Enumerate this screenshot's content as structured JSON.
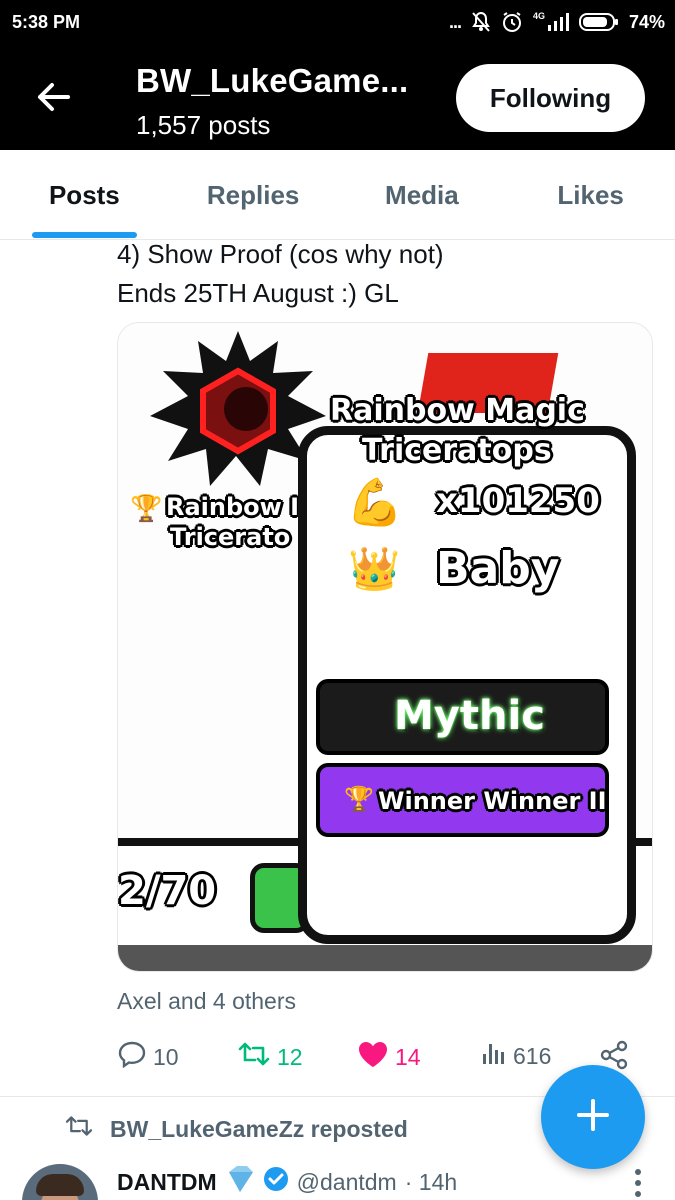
{
  "status_bar": {
    "time": "5:38 PM",
    "dots": "...",
    "network": "4G",
    "battery": "74%"
  },
  "header": {
    "title": "BW_LukeGame...",
    "subtitle": "1,557 posts",
    "follow_label": "Following"
  },
  "tabs": [
    {
      "label": "Posts",
      "active": true
    },
    {
      "label": "Replies",
      "active": false
    },
    {
      "label": "Media",
      "active": false
    },
    {
      "label": "Likes",
      "active": false
    }
  ],
  "tweet": {
    "lines": [
      "4) Show Proof (cos why not)",
      "Ends 25TH August :) GL"
    ],
    "media": {
      "pet_name_line1": "Rainbow Magic",
      "pet_name_line2": "Triceratops",
      "power": "x101250",
      "size": "Baby",
      "rarity": "Mythic",
      "title_badge": "Winner Winner II",
      "slot_count": "2/70",
      "bg_name_line1": "Rainbow I",
      "bg_name_line2": "Tricerato"
    },
    "liked_by": "Axel and 4 others",
    "actions": {
      "replies": "10",
      "reposts": "12",
      "likes": "14",
      "views": "616"
    },
    "colors": {
      "repost": "#00ba7c",
      "like": "#f91880",
      "accent": "#1d9bf0"
    }
  },
  "repost_banner": "BW_LukeGameZz reposted",
  "next_tweet": {
    "name": "DANTDM",
    "handle": "@dantdm",
    "time": "· 14h"
  }
}
